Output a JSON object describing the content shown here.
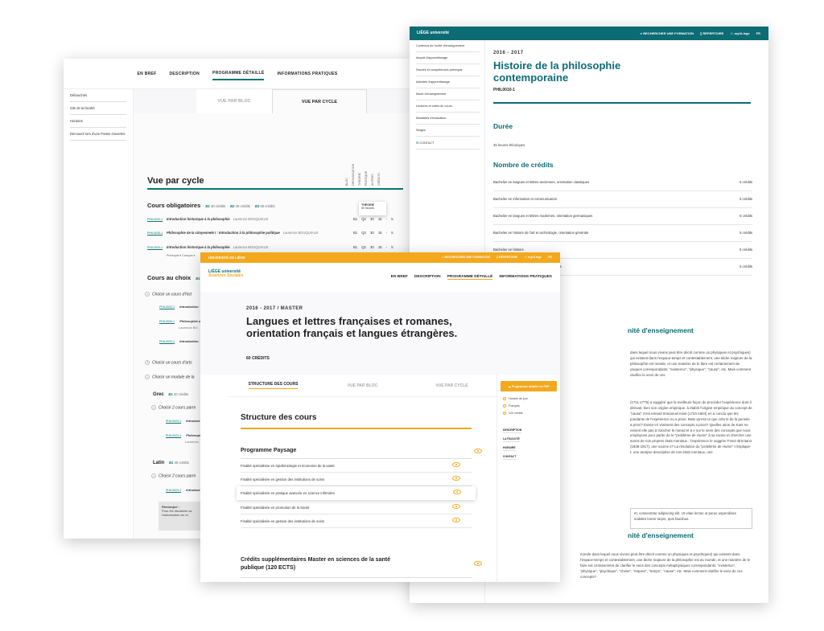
{
  "left_window": {
    "topnav": [
      "EN BREF",
      "DESCRIPTION",
      "PROGRAMME DÉTAILLÉ",
      "INFORMATIONS PRATIQUES"
    ],
    "sidebar": [
      "Débouchés",
      "Sits de la faculté",
      "Horaires",
      "Découvrir lors d'une Portes Ouvertes"
    ],
    "view_tabs": {
      "bloc": "VUE PAR BLOC",
      "cycle": "VUE PAR CYCLE"
    },
    "title": "Vue par cycle",
    "columns": [
      "BLOC",
      "ORGANISATION",
      "THÉORIE",
      "PRATIQUE",
      "AUTRES",
      "CRÉDITS"
    ],
    "tooltip": {
      "title": "THÉORIE",
      "value": "30 heures"
    },
    "mandatory": {
      "title": "Cours obligatoires",
      "b1": "B1",
      "b1_cred": "40 crédits",
      "b2": "B2",
      "b2_cred": "40 crédits",
      "b3": "B3",
      "b3_cred": "40 crédits"
    },
    "rows": [
      {
        "code": "PHIL0033-1",
        "name": "Introduction historique à la philosophie",
        "prof": "Laurence BOUQUIAUX",
        "vals": "B1  Q2  30  15  -  5"
      },
      {
        "code": "PHIL0035-1",
        "name": "Philosophie de la citoyenneté I : Introduction à la philosophie politique",
        "prof": "Laurence BOUQUIAUX",
        "vals": "B1  Q2  30  15  -  5"
      },
      {
        "code": "PHIL0033-1",
        "name": "Introduction historique à la philosophie",
        "prof": "Laurence BOUQUIAUX",
        "vals": "B1  Q2  30  15  -  5"
      }
    ],
    "row_filters": "Prérequis ▾    Campus ▾",
    "optional": {
      "title": "Cours au choix",
      "b1": "B1",
      "b1_cred": "40 crédits",
      "b2": "B2",
      "b2_cred": "40 crédits"
    },
    "choices": [
      "Choisir un cours d'hist",
      "Choisir un cours d'arts",
      "Choisir un module de la"
    ],
    "subs": [
      {
        "code": "PHIL0023-1",
        "name": "Introduction"
      },
      {
        "code": "PHIL0025-1",
        "name": "Philosophie d"
      },
      {
        "prof": "Laurence BO"
      },
      {
        "code": "PHIL0023-1",
        "name": "Introduction"
      }
    ],
    "groups": [
      {
        "name": "Grec",
        "b": "B1",
        "cred": "40 crédits",
        "choice": "Choisir 2 cours parm",
        "subs": [
          "Introduct",
          "Philosoph",
          "Laurence"
        ]
      },
      {
        "name": "Latin",
        "b": "B1",
        "cred": "40 crédits",
        "choice": "Choisir 2 cours parm",
        "subs": [
          "Introduct",
          "Philosoph",
          "Laurence"
        ]
      }
    ],
    "sub_code": "PHIL0023-1",
    "remark": {
      "title": "Remarque :",
      "text": "Pour les étudiants sa l'autorisation du co"
    }
  },
  "right_window": {
    "bar": {
      "logo": "LIÈGE université",
      "search": "RECHERCHER UNE FORMATION",
      "repertoire": "RÉPERTOIRE",
      "myulg": "myULiège",
      "lang": "FR"
    },
    "sidebar": [
      "Contenus de l'unité d'enseignement",
      "Acquis d'apprentissage",
      "Savoirs et compétences prérequis",
      "Activités d'apprentissage",
      "Mode d'enseignement",
      "Lectures et notes de cours",
      "Modalités d'évaluation",
      "Stages",
      "CONTACT"
    ],
    "year": "2016 - 2017",
    "title": "Histoire de la philosophie contemporaine",
    "code": "PHIL0010-1",
    "duree_title": "Durée",
    "duree_value": "45 heures théoriques",
    "credits_title": "Nombre de crédits",
    "credits": [
      {
        "label": "Bachelier en langues et lettres anciennes, orientation classiques",
        "value": "5 crédits"
      },
      {
        "label": "Bachelier en information et communication",
        "value": "5 crédits"
      },
      {
        "label": "Bachelier en langues et lettres modernes, orientation germaniques",
        "value": "5 crédits"
      },
      {
        "label": "Bachelier en histoire de l'art et archéologie, orientation générale",
        "value": "5 crédits"
      },
      {
        "label": "Bachelier en histoire",
        "value": "5 crédits"
      },
      {
        "label": "Bachelier en philosophie, orientation générale",
        "value": "5 crédits"
      }
    ],
    "section1_title": "nité d'enseignement",
    "text1": "dans lequel nous vivons peut être décrit comme un physiques et psychiques) qui existent dans l'espace-temps et contestablement, une tâche majeure de la philosophie est monde, et une manière de le faire est certainement de ysiques correspondants: \"existence\", \"physique\", \"cause\", etc. Mais comment clarifier le sens de ces",
    "text2": "(1711-1776) a suggéré que la meilleure façon de procéder l'expérience dont il dérivait, bien son origine empirique. à établir l'origine empirique du concept de \"cause\" s'est emand Immanuel Kant (1724-1804) en a conclu que les pondants de l'expérience ou a priori. Mais qu'est-ce que cela ts de la pensée a priori? Existe-t-il vraiment des concepts a priori? Quelles ution de Kant ne revient elle pas à trancher le noeud et à e sur le sens des concepts que nous employons pour parler de le \"problème de Hume\" à sa racine et chercher une avons de nos propres états mentaux : l'expérience le suggère Franz Brentano (1838-1917), une source s? La résolution du \"problème de Hume\" n'implique-t- une analyse descriptive de nos états mentaux, une",
    "quote": "et, consectetur adipiscing elit. Ut vitae lectus ut purus uspendisse sodales lorem turpis, quis faucibus.",
    "section2_title": "nité d'enseignement",
    "text3": "monde dans lequel nous vivons peut être décrit comme un physiques et psychiques) qui existent dans l'espace-temps et contestablement, une tâche majeure de la philosophie est du monde, et une manière de le faire est certainement de clarifier le sens des concepts métaphysiques correspondants: \"existence\", \"physique\", \"psychique\", \"chose\", \"espace\", \"temps\", \"cause\", etc. Mais comment clarifier le sens de ces concepts?"
  },
  "front_window": {
    "bar": {
      "brand": "UNIVERSITÉ DE LIÈGE",
      "search": "RECHERCHER UNE FORMATION",
      "repertoire": "RÉPERTOIRE",
      "myulg": "myULiège",
      "lang": "FR"
    },
    "logo": {
      "top": "LIÈGE université",
      "bottom": "Sciences Sociales"
    },
    "nav": [
      "EN BREF",
      "DESCRIPTION",
      "PROGRAMME DÉTAILLÉ",
      "INFORMATIONS PRATIQUES"
    ],
    "year": "2016 - 2017 / MASTER",
    "title": "Langues et lettres françaises et romanes, orientation français et langues étrangères.",
    "ects": "60 CRÉDITS",
    "tabs": [
      "STRUCTURE DES COURS",
      "VUE PAR BLOC",
      "VUE PAR CYCLE"
    ],
    "section_title": "Structure des cours",
    "program_title": "Programme Paysage",
    "items": [
      "Finalité spécialisée en épidémiologie et économie de la santé",
      "Finalité spécialisée en gestion des institutions de soins",
      "Finalité spécialisée en pratique avancée en science infirmière",
      "Finalité spécialisée en promotion de la Santé",
      "Finalité spécialisée en gestion des institutions de soins"
    ],
    "credits_block": "Crédits supplémentaires Master en sciences de la santé publique (120 ECTS)",
    "side": {
      "pdf": "Programme détaillé en PDF",
      "meta": [
        "Horaire de jour",
        "Français",
        "120 crédits"
      ],
      "links": [
        "DESCRIPTION",
        "LA FACULTÉ",
        "HORAIRE",
        "CONTACT"
      ]
    }
  },
  "colors": {
    "teal": "#0c6c74",
    "orange": "#f3a81d"
  }
}
